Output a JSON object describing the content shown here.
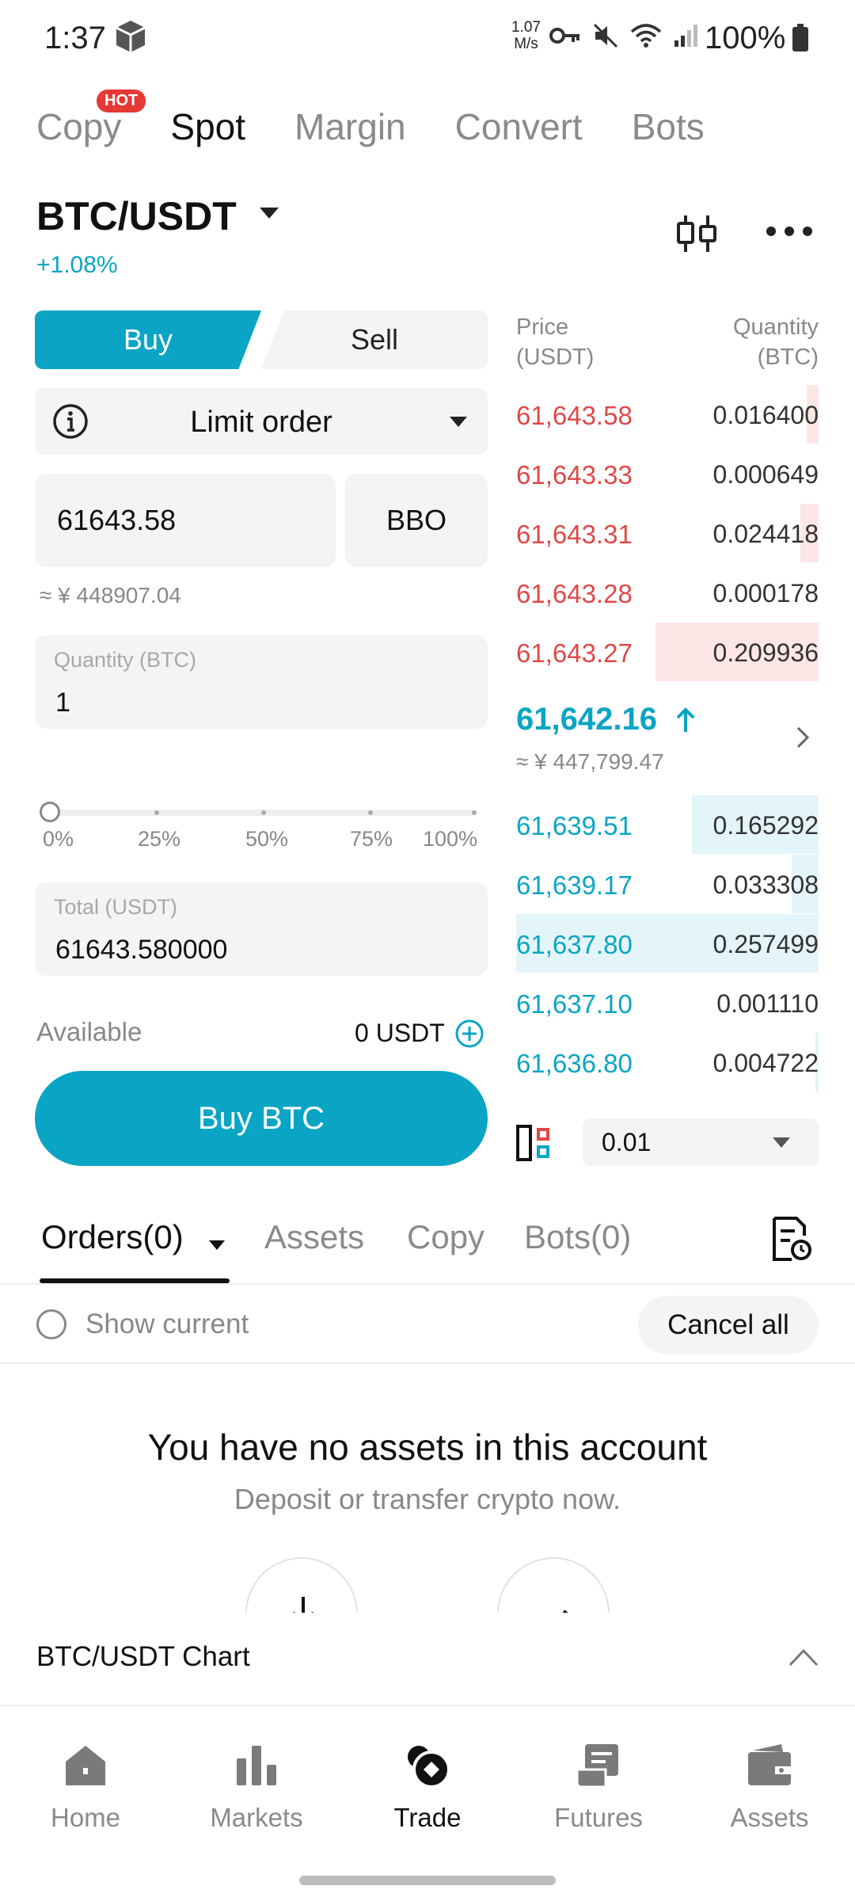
{
  "status_bar": {
    "time": "1:37",
    "speed_top": "1.07",
    "speed_bottom": "M/s",
    "battery": "100%"
  },
  "top_tabs": [
    {
      "label": "Copy",
      "badge": "HOT"
    },
    {
      "label": "Spot",
      "active": true
    },
    {
      "label": "Margin"
    },
    {
      "label": "Convert"
    },
    {
      "label": "Bots"
    }
  ],
  "pair": {
    "symbol": "BTC/USDT",
    "change": "+1.08%"
  },
  "trade_form": {
    "buy_label": "Buy",
    "sell_label": "Sell",
    "order_type": "Limit order",
    "price_value": "61643.58",
    "bbo_label": "BBO",
    "price_cny": "≈ ¥ 448907.04",
    "quantity_label": "Quantity (BTC)",
    "quantity_value": "1",
    "slider_percent": 0,
    "slider_marks": [
      "0%",
      "25%",
      "50%",
      "75%",
      "100%"
    ],
    "total_label": "Total (USDT)",
    "total_value": "61643.580000",
    "available_label": "Available",
    "available_value": "0 USDT",
    "submit_label": "Buy BTC"
  },
  "order_book": {
    "price_header_1": "Price",
    "price_header_2": "(USDT)",
    "qty_header_1": "Quantity",
    "qty_header_2": "(BTC)",
    "asks": [
      {
        "price": "61,643.58",
        "qty": "0.016400",
        "depth": 0.04
      },
      {
        "price": "61,643.33",
        "qty": "0.000649",
        "depth": 0.0
      },
      {
        "price": "61,643.31",
        "qty": "0.024418",
        "depth": 0.06
      },
      {
        "price": "61,643.28",
        "qty": "0.000178",
        "depth": 0.0
      },
      {
        "price": "61,643.27",
        "qty": "0.209936",
        "depth": 0.54
      }
    ],
    "last_price": "61,642.16",
    "last_price_cny": "≈ ¥ 447,799.47",
    "bids": [
      {
        "price": "61,639.51",
        "qty": "0.165292",
        "depth": 0.42
      },
      {
        "price": "61,639.17",
        "qty": "0.033308",
        "depth": 0.09
      },
      {
        "price": "61,637.80",
        "qty": "0.257499",
        "depth": 1.0
      },
      {
        "price": "61,637.10",
        "qty": "0.001110",
        "depth": 0.0
      },
      {
        "price": "61,636.80",
        "qty": "0.004722",
        "depth": 0.01
      }
    ],
    "tick_size": "0.01"
  },
  "bottom_tabs": {
    "orders": "Orders(0)",
    "assets": "Assets",
    "copy": "Copy",
    "bots": "Bots(0)",
    "show_current": "Show current",
    "cancel_all": "Cancel all"
  },
  "empty_state": {
    "title": "You have no assets in this account",
    "subtitle": "Deposit or transfer crypto now."
  },
  "chart_bar": {
    "label": "BTC/USDT Chart"
  },
  "nav": [
    {
      "label": "Home",
      "icon": "home-icon"
    },
    {
      "label": "Markets",
      "icon": "markets-icon"
    },
    {
      "label": "Trade",
      "icon": "trade-icon",
      "active": true
    },
    {
      "label": "Futures",
      "icon": "futures-icon"
    },
    {
      "label": "Assets",
      "icon": "assets-icon"
    }
  ],
  "colors": {
    "accent": "#0aa5c4",
    "ask": "#e04848",
    "bid": "#0aa5c4",
    "badge": "#e53935"
  }
}
